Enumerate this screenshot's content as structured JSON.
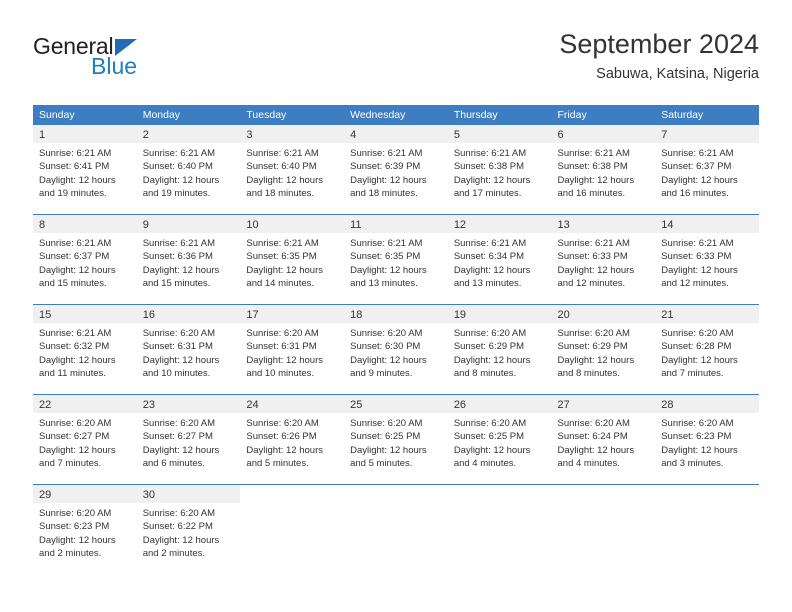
{
  "logo": {
    "word_top": "General",
    "word_bottom": "Blue",
    "triangle": "blue-triangle-icon",
    "color_dark": "#231f20",
    "color_blue": "#1f7ec4"
  },
  "title": {
    "month_year": "September 2024",
    "location": "Sabuwa, Katsina, Nigeria"
  },
  "theme": {
    "header_blue": "#3c7ec1",
    "daynum_band": "#f0f0f0",
    "text": "#333333"
  },
  "calendar": {
    "weekday_headers": [
      "Sunday",
      "Monday",
      "Tuesday",
      "Wednesday",
      "Thursday",
      "Friday",
      "Saturday"
    ],
    "weeks": [
      [
        {
          "day": "1",
          "sunrise": "Sunrise: 6:21 AM",
          "sunset": "Sunset: 6:41 PM",
          "daylight_1": "Daylight: 12 hours",
          "daylight_2": "and 19 minutes."
        },
        {
          "day": "2",
          "sunrise": "Sunrise: 6:21 AM",
          "sunset": "Sunset: 6:40 PM",
          "daylight_1": "Daylight: 12 hours",
          "daylight_2": "and 19 minutes."
        },
        {
          "day": "3",
          "sunrise": "Sunrise: 6:21 AM",
          "sunset": "Sunset: 6:40 PM",
          "daylight_1": "Daylight: 12 hours",
          "daylight_2": "and 18 minutes."
        },
        {
          "day": "4",
          "sunrise": "Sunrise: 6:21 AM",
          "sunset": "Sunset: 6:39 PM",
          "daylight_1": "Daylight: 12 hours",
          "daylight_2": "and 18 minutes."
        },
        {
          "day": "5",
          "sunrise": "Sunrise: 6:21 AM",
          "sunset": "Sunset: 6:38 PM",
          "daylight_1": "Daylight: 12 hours",
          "daylight_2": "and 17 minutes."
        },
        {
          "day": "6",
          "sunrise": "Sunrise: 6:21 AM",
          "sunset": "Sunset: 6:38 PM",
          "daylight_1": "Daylight: 12 hours",
          "daylight_2": "and 16 minutes."
        },
        {
          "day": "7",
          "sunrise": "Sunrise: 6:21 AM",
          "sunset": "Sunset: 6:37 PM",
          "daylight_1": "Daylight: 12 hours",
          "daylight_2": "and 16 minutes."
        }
      ],
      [
        {
          "day": "8",
          "sunrise": "Sunrise: 6:21 AM",
          "sunset": "Sunset: 6:37 PM",
          "daylight_1": "Daylight: 12 hours",
          "daylight_2": "and 15 minutes."
        },
        {
          "day": "9",
          "sunrise": "Sunrise: 6:21 AM",
          "sunset": "Sunset: 6:36 PM",
          "daylight_1": "Daylight: 12 hours",
          "daylight_2": "and 15 minutes."
        },
        {
          "day": "10",
          "sunrise": "Sunrise: 6:21 AM",
          "sunset": "Sunset: 6:35 PM",
          "daylight_1": "Daylight: 12 hours",
          "daylight_2": "and 14 minutes."
        },
        {
          "day": "11",
          "sunrise": "Sunrise: 6:21 AM",
          "sunset": "Sunset: 6:35 PM",
          "daylight_1": "Daylight: 12 hours",
          "daylight_2": "and 13 minutes."
        },
        {
          "day": "12",
          "sunrise": "Sunrise: 6:21 AM",
          "sunset": "Sunset: 6:34 PM",
          "daylight_1": "Daylight: 12 hours",
          "daylight_2": "and 13 minutes."
        },
        {
          "day": "13",
          "sunrise": "Sunrise: 6:21 AM",
          "sunset": "Sunset: 6:33 PM",
          "daylight_1": "Daylight: 12 hours",
          "daylight_2": "and 12 minutes."
        },
        {
          "day": "14",
          "sunrise": "Sunrise: 6:21 AM",
          "sunset": "Sunset: 6:33 PM",
          "daylight_1": "Daylight: 12 hours",
          "daylight_2": "and 12 minutes."
        }
      ],
      [
        {
          "day": "15",
          "sunrise": "Sunrise: 6:21 AM",
          "sunset": "Sunset: 6:32 PM",
          "daylight_1": "Daylight: 12 hours",
          "daylight_2": "and 11 minutes."
        },
        {
          "day": "16",
          "sunrise": "Sunrise: 6:20 AM",
          "sunset": "Sunset: 6:31 PM",
          "daylight_1": "Daylight: 12 hours",
          "daylight_2": "and 10 minutes."
        },
        {
          "day": "17",
          "sunrise": "Sunrise: 6:20 AM",
          "sunset": "Sunset: 6:31 PM",
          "daylight_1": "Daylight: 12 hours",
          "daylight_2": "and 10 minutes."
        },
        {
          "day": "18",
          "sunrise": "Sunrise: 6:20 AM",
          "sunset": "Sunset: 6:30 PM",
          "daylight_1": "Daylight: 12 hours",
          "daylight_2": "and 9 minutes."
        },
        {
          "day": "19",
          "sunrise": "Sunrise: 6:20 AM",
          "sunset": "Sunset: 6:29 PM",
          "daylight_1": "Daylight: 12 hours",
          "daylight_2": "and 8 minutes."
        },
        {
          "day": "20",
          "sunrise": "Sunrise: 6:20 AM",
          "sunset": "Sunset: 6:29 PM",
          "daylight_1": "Daylight: 12 hours",
          "daylight_2": "and 8 minutes."
        },
        {
          "day": "21",
          "sunrise": "Sunrise: 6:20 AM",
          "sunset": "Sunset: 6:28 PM",
          "daylight_1": "Daylight: 12 hours",
          "daylight_2": "and 7 minutes."
        }
      ],
      [
        {
          "day": "22",
          "sunrise": "Sunrise: 6:20 AM",
          "sunset": "Sunset: 6:27 PM",
          "daylight_1": "Daylight: 12 hours",
          "daylight_2": "and 7 minutes."
        },
        {
          "day": "23",
          "sunrise": "Sunrise: 6:20 AM",
          "sunset": "Sunset: 6:27 PM",
          "daylight_1": "Daylight: 12 hours",
          "daylight_2": "and 6 minutes."
        },
        {
          "day": "24",
          "sunrise": "Sunrise: 6:20 AM",
          "sunset": "Sunset: 6:26 PM",
          "daylight_1": "Daylight: 12 hours",
          "daylight_2": "and 5 minutes."
        },
        {
          "day": "25",
          "sunrise": "Sunrise: 6:20 AM",
          "sunset": "Sunset: 6:25 PM",
          "daylight_1": "Daylight: 12 hours",
          "daylight_2": "and 5 minutes."
        },
        {
          "day": "26",
          "sunrise": "Sunrise: 6:20 AM",
          "sunset": "Sunset: 6:25 PM",
          "daylight_1": "Daylight: 12 hours",
          "daylight_2": "and 4 minutes."
        },
        {
          "day": "27",
          "sunrise": "Sunrise: 6:20 AM",
          "sunset": "Sunset: 6:24 PM",
          "daylight_1": "Daylight: 12 hours",
          "daylight_2": "and 4 minutes."
        },
        {
          "day": "28",
          "sunrise": "Sunrise: 6:20 AM",
          "sunset": "Sunset: 6:23 PM",
          "daylight_1": "Daylight: 12 hours",
          "daylight_2": "and 3 minutes."
        }
      ],
      [
        {
          "day": "29",
          "sunrise": "Sunrise: 6:20 AM",
          "sunset": "Sunset: 6:23 PM",
          "daylight_1": "Daylight: 12 hours",
          "daylight_2": "and 2 minutes."
        },
        {
          "day": "30",
          "sunrise": "Sunrise: 6:20 AM",
          "sunset": "Sunset: 6:22 PM",
          "daylight_1": "Daylight: 12 hours",
          "daylight_2": "and 2 minutes."
        },
        {
          "day": "",
          "sunrise": "",
          "sunset": "",
          "daylight_1": "",
          "daylight_2": ""
        },
        {
          "day": "",
          "sunrise": "",
          "sunset": "",
          "daylight_1": "",
          "daylight_2": ""
        },
        {
          "day": "",
          "sunrise": "",
          "sunset": "",
          "daylight_1": "",
          "daylight_2": ""
        },
        {
          "day": "",
          "sunrise": "",
          "sunset": "",
          "daylight_1": "",
          "daylight_2": ""
        },
        {
          "day": "",
          "sunrise": "",
          "sunset": "",
          "daylight_1": "",
          "daylight_2": ""
        }
      ]
    ]
  }
}
